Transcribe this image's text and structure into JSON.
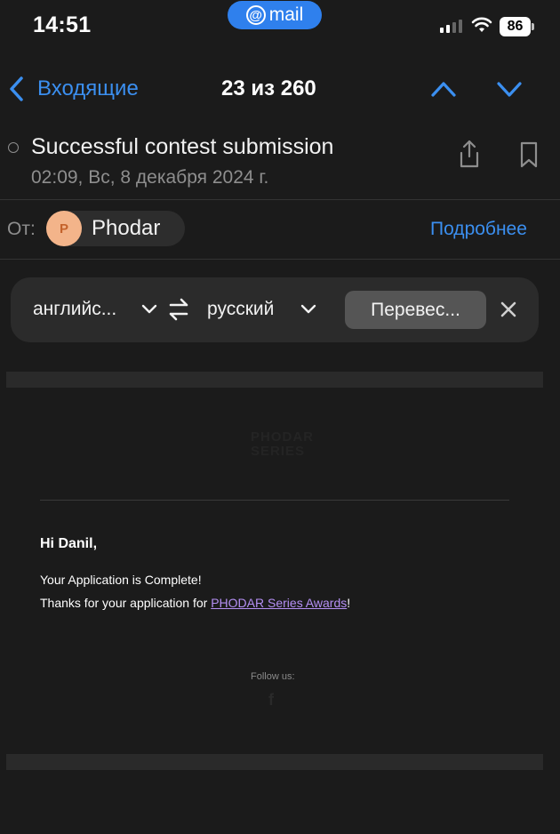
{
  "status_bar": {
    "time": "14:51",
    "app_pill": "mail",
    "battery": "86"
  },
  "nav": {
    "back_label": "Входящие",
    "counter": "23 из 260"
  },
  "message": {
    "subject": "Successful contest submission",
    "date": "02:09, Вс, 8 декабря 2024 г.",
    "from_label": "От:",
    "sender_initial": "P",
    "sender_name": "Phodar",
    "details_link": "Подробнее"
  },
  "translate": {
    "from_lang": "английс...",
    "to_lang": "русский",
    "button": "Перевес..."
  },
  "email_body": {
    "logo_line1": "PHODAR",
    "logo_line2": "SERIES",
    "greeting": "Hi Danil,",
    "line1": "Your Application is Complete!",
    "line2_prefix": "Thanks for your application for ",
    "line2_link": "PHODAR Series Awards",
    "line2_suffix": "!",
    "follow_us": "Follow us:",
    "social_icon": "f"
  },
  "colors": {
    "accent": "#3b8ff0",
    "background": "#1b1b1b",
    "link": "#b48ff3"
  }
}
